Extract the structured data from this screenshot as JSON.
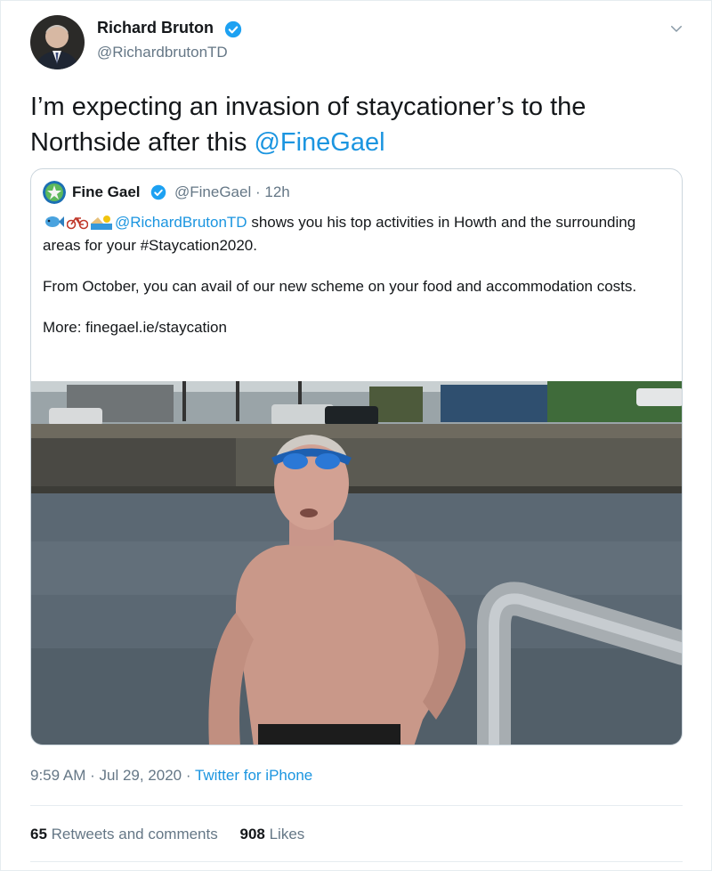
{
  "author": {
    "name": "Richard Bruton",
    "handle": "@RichardbrutonTD",
    "verified": true
  },
  "tweet": {
    "text_part1": "I’m expecting an invasion of staycationer’s to the Northside after this ",
    "mention": "@FineGael"
  },
  "quoted_tweet": {
    "name": "Fine Gael",
    "handle": "@FineGael",
    "time": "12h",
    "verified": true,
    "emojis": [
      "fish-emoji",
      "bicycle-emoji",
      "beach-emoji"
    ],
    "line1_mention": "@RichardBrutonTD",
    "line1_text": " shows you his top activities in Howth and the surrounding areas for your #Staycation2020.",
    "line2_text": "From October, you can avail of our new scheme on your food and accommodation costs.",
    "line3_text": "More: finegael.ie/staycation",
    "media": "video-still-man-swimming-harbour"
  },
  "meta": {
    "time": "9:59 AM",
    "date": "Jul 29, 2020",
    "source": "Twitter for iPhone"
  },
  "stats": {
    "retweets_count": "65",
    "retweets_label": "Retweets and comments",
    "likes_count": "908",
    "likes_label": "Likes"
  },
  "colors": {
    "link": "#1b95e0",
    "secondary": "#657786",
    "verified": "#1da1f2",
    "border": "#ccd6dd"
  }
}
